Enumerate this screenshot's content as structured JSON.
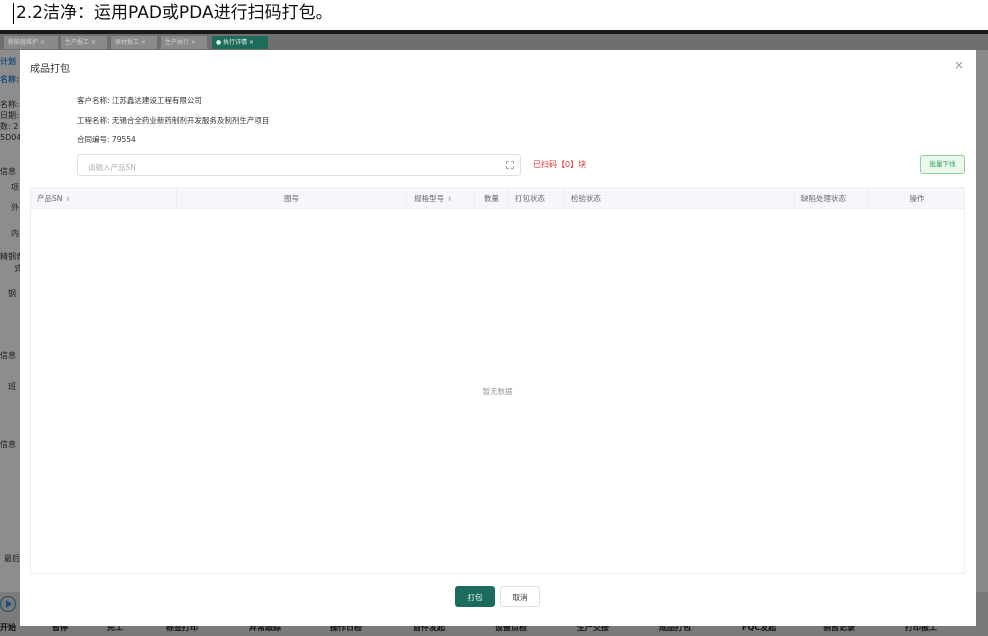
{
  "caption": {
    "text": "2.2洁净：运用PAD或PDA进行扫码打包。"
  },
  "tabs": [
    {
      "label": "新陷器维护 ×",
      "active": false
    },
    {
      "label": "生产报工 ×",
      "active": false
    },
    {
      "label": "原材报工 ×",
      "active": false
    },
    {
      "label": "生产执行 ×",
      "active": false
    },
    {
      "label": "● 执行详情 ×",
      "active": true
    }
  ],
  "left_panel": {
    "labels": [
      "计划",
      "名称:",
      "名称:",
      "日期:",
      "数: 2",
      "5D04",
      "信息",
      "项",
      "外",
      "内",
      "精钢表",
      "式",
      "钢",
      "信息",
      "班",
      "信息",
      "最后"
    ]
  },
  "bottom_bar": {
    "labels": [
      "开始",
      "暂停",
      "完工",
      "标签打印",
      "异常跟踪",
      "操作日检",
      "首件发起",
      "设备点检",
      "生产交接",
      "成品打包",
      "FQC发起",
      "销售记录",
      "打印报工"
    ]
  },
  "modal": {
    "title": "成品打包",
    "close_icon": "close-icon",
    "customer_label": "客户名称:",
    "customer_value": "江苏鑫达建设工程有限公司",
    "project_label": "工程名称:",
    "project_value": "无锡合全药业新药制剂开发服务及制剂生产项目",
    "contract_label": "合同编号:",
    "contract_value": "79554",
    "search_placeholder": "请输入产品SN",
    "scanned_text": "已扫码【0】块",
    "batch_button": "批量下线",
    "columns": [
      "产品SN",
      "图号",
      "规格型号",
      "数量",
      "打包状态",
      "检验状态",
      "缺陷处理状态",
      "操作"
    ],
    "empty_text": "暂无数据",
    "pack_button": "打包",
    "cancel_button": "取消"
  },
  "colors": {
    "primary": "#1b6b5f",
    "danger": "#e0342f",
    "success": "#2e9b4e"
  }
}
